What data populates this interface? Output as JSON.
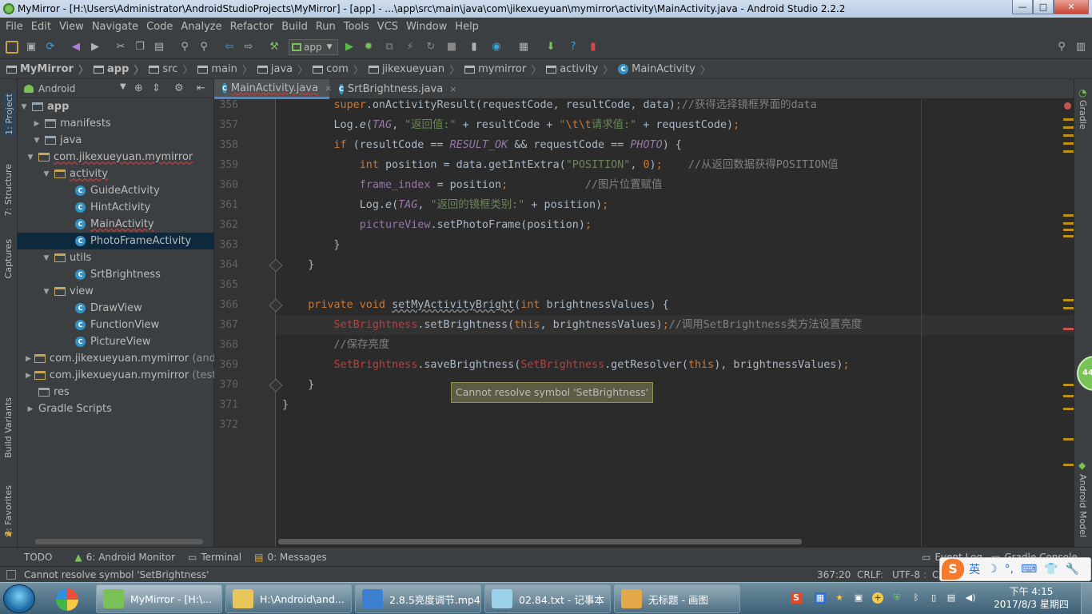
{
  "window": {
    "title": "MyMirror - [H:\\Users\\Administrator\\AndroidStudioProjects\\MyMirror] - [app] - ...\\app\\src\\main\\java\\com\\jikexueyuan\\mymirror\\activity\\MainActivity.java - Android Studio 2.2.2",
    "minimize": "—",
    "maximize": "□",
    "close": "✕"
  },
  "menu": [
    "File",
    "Edit",
    "View",
    "Navigate",
    "Code",
    "Analyze",
    "Refactor",
    "Build",
    "Run",
    "Tools",
    "VCS",
    "Window",
    "Help"
  ],
  "toolbar": {
    "run_config": "app",
    "icons": [
      "open-icon",
      "save-icon",
      "sync-icon",
      "undo-icon",
      "redo-icon",
      "cut-icon",
      "copy-icon",
      "paste-icon",
      "find-icon",
      "replace-icon",
      "back-icon",
      "forward-icon",
      "make-icon",
      "run-icon",
      "debug-icon",
      "attach-icon",
      "stop-icon",
      "sdk-icon",
      "avd-icon",
      "structure-icon",
      "help-icon",
      "monitor-icon",
      "search-icon"
    ]
  },
  "breadcrumb": [
    "MyMirror",
    "app",
    "src",
    "main",
    "java",
    "com",
    "jikexueyuan",
    "mymirror",
    "activity",
    "MainActivity"
  ],
  "left_strip": {
    "project": "1: Project",
    "structure": "7: Structure",
    "captures": "Captures",
    "build_variants": "Build Variants",
    "favorites": "2: Favorites"
  },
  "right_strip": {
    "gradle": "Gradle",
    "android_model": "Android Model",
    "badge": "44"
  },
  "project_panel": {
    "view_mode": "Android",
    "tree": [
      {
        "label": "app",
        "extra": ""
      },
      {
        "label": "manifests",
        "extra": ""
      },
      {
        "label": "java",
        "extra": ""
      },
      {
        "label": "com.jikexueyuan.mymirror",
        "extra": ""
      },
      {
        "label": "activity",
        "extra": ""
      },
      {
        "label": "GuideActivity",
        "extra": ""
      },
      {
        "label": "HintActivity",
        "extra": ""
      },
      {
        "label": "MainActivity",
        "extra": ""
      },
      {
        "label": "PhotoFrameActivity",
        "extra": ""
      },
      {
        "label": "utils",
        "extra": ""
      },
      {
        "label": "SrtBrightness",
        "extra": ""
      },
      {
        "label": "view",
        "extra": ""
      },
      {
        "label": "DrawView",
        "extra": ""
      },
      {
        "label": "FunctionView",
        "extra": ""
      },
      {
        "label": "PictureView",
        "extra": ""
      },
      {
        "label": "com.jikexueyuan.mymirror",
        "extra": "(andro"
      },
      {
        "label": "com.jikexueyuan.mymirror",
        "extra": "(test)"
      },
      {
        "label": "res",
        "extra": ""
      },
      {
        "label": "Gradle Scripts",
        "extra": ""
      }
    ]
  },
  "tabs": [
    {
      "label": "MainActivity.java",
      "close": "×"
    },
    {
      "label": "SrtBrightness.java",
      "close": "×"
    }
  ],
  "editor": {
    "line_numbers": [
      "356",
      "357",
      "358",
      "359",
      "360",
      "361",
      "362",
      "363",
      "364",
      "365",
      "366",
      "367",
      "368",
      "369",
      "370",
      "371",
      "372"
    ],
    "tooltip": "Cannot resolve symbol 'SetBrightness'"
  },
  "bottom_tools": [
    {
      "label": "TODO"
    },
    {
      "label": "6: Android Monitor"
    },
    {
      "label": "Terminal"
    },
    {
      "label": "0: Messages"
    },
    {
      "label": "Event Log"
    },
    {
      "label": "Gradle Console"
    }
  ],
  "status": {
    "message": "Cannot resolve symbol 'SetBrightness'",
    "position": "367:20",
    "line_sep": "CRLF",
    "encoding": "UTF-8",
    "context": "C"
  },
  "ime": {
    "logo": "S",
    "lang": "英",
    "icons": [
      "moon-icon",
      "punct-icon",
      "keyboard-icon",
      "shirt-icon",
      "wrench-icon"
    ]
  },
  "taskbar": {
    "tasks": [
      {
        "label": "MyMirror - [H:\\..."
      },
      {
        "label": "H:\\Android\\and..."
      },
      {
        "label": "2.8.5亮度调节.mp4"
      },
      {
        "label": "02.84.txt - 记事本"
      },
      {
        "label": "无标题 - 画图"
      }
    ],
    "clock_time": "下午 4:15",
    "clock_date": "2017/8/3 星期四"
  }
}
